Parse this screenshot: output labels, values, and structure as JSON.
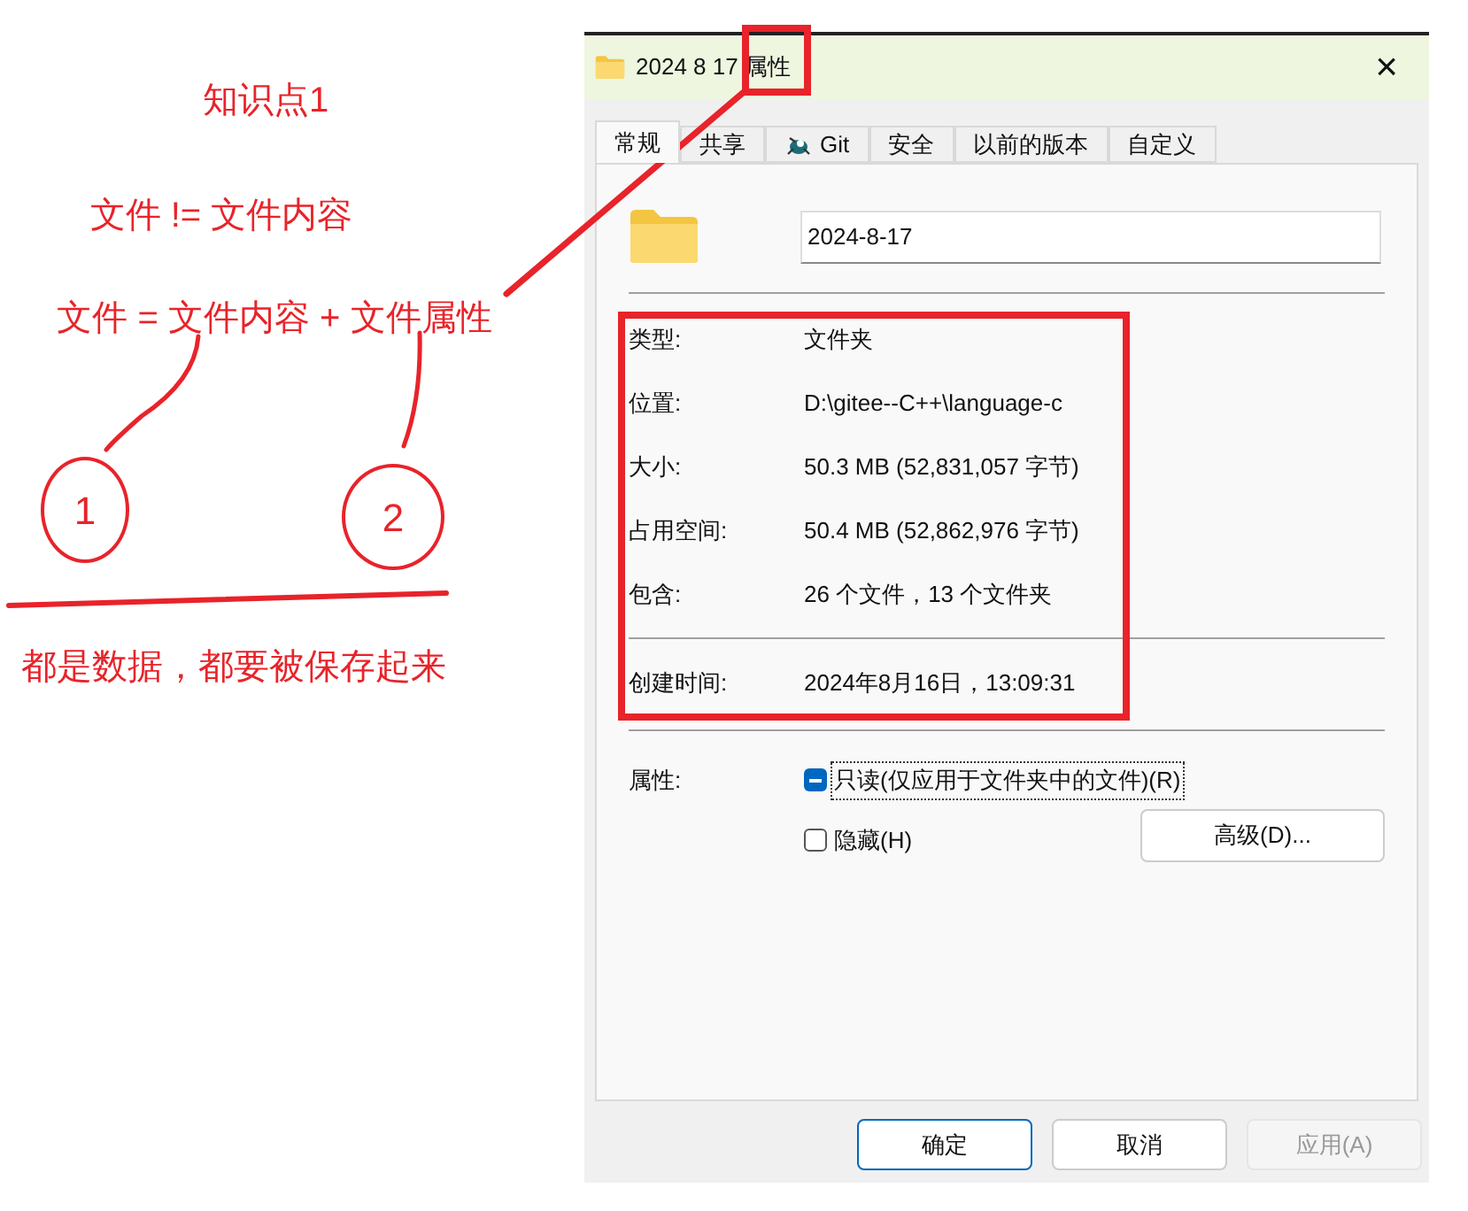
{
  "notes": {
    "heading": "知识点1",
    "line_1": "文件 != 文件内容",
    "line_2": "文件 = 文件内容 + 文件属性",
    "circle_1": "1",
    "circle_2": "2",
    "conclusion": "都是数据，都要被保存起来"
  },
  "window": {
    "title": "2024 8 17 属性",
    "close": "×"
  },
  "tabs": [
    {
      "label": "常规",
      "selected": true
    },
    {
      "label": "共享",
      "selected": false
    },
    {
      "label": "Git",
      "selected": false,
      "icon": true
    },
    {
      "label": "安全",
      "selected": false
    },
    {
      "label": "以前的版本",
      "selected": false
    },
    {
      "label": "自定义",
      "selected": false
    }
  ],
  "name_field": {
    "value": "2024-8-17"
  },
  "details": [
    {
      "label": "类型:",
      "value": "文件夹"
    },
    {
      "label": "位置:",
      "value": "D:\\gitee--C++\\language-c"
    },
    {
      "label": "大小:",
      "value": "50.3 MB (52,831,057 字节)"
    },
    {
      "label": "占用空间:",
      "value": "50.4 MB (52,862,976 字节)"
    },
    {
      "label": "包含:",
      "value": "26 个文件，13 个文件夹"
    }
  ],
  "created": {
    "label": "创建时间:",
    "value": "2024年8月16日，13:09:31"
  },
  "attributes": {
    "label": "属性:",
    "options": [
      {
        "label": "只读(仅应用于文件夹中的文件)(R)",
        "checked": false,
        "indeterminate": true,
        "focused": true
      },
      {
        "label": "隐藏(H)",
        "checked": false,
        "indeterminate": false,
        "focused": false
      }
    ],
    "advanced": "高级(D)..."
  },
  "buttons": [
    {
      "label": "确定",
      "kind": "default",
      "disabled": false
    },
    {
      "label": "取消",
      "kind": "normal",
      "disabled": false
    },
    {
      "label": "应用(A)",
      "kind": "normal",
      "disabled": true
    }
  ]
}
